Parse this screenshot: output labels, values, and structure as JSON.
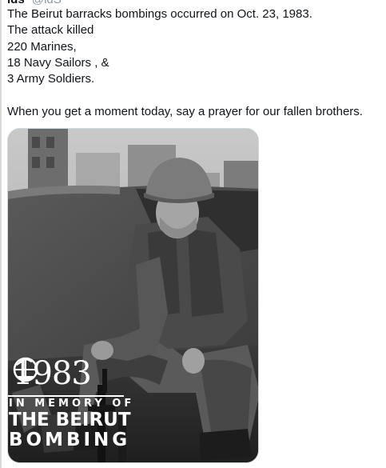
{
  "tweet": {
    "author_name": "lds",
    "author_handle": "@ldS",
    "lines": [
      "The Beirut barracks bombings occurred on Oct. 23, 1983.",
      "The attack killed",
      "220 Marines,",
      "18 Navy Sailors , &",
      "3 Army Soldiers.",
      "",
      "When you get a moment today, say a prayer for our fallen brothers."
    ]
  },
  "media": {
    "year": "1983",
    "memory_line": "IN MEMORY OF",
    "title_line1": "THE BEIRUT",
    "title_line2": "BOMBING",
    "emblem_icon": "marine-corps-emblem-icon"
  }
}
